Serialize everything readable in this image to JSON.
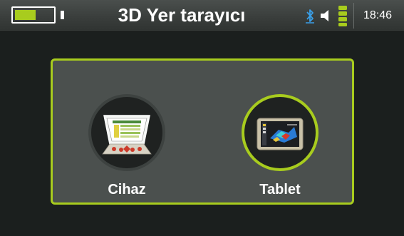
{
  "status_bar": {
    "battery_level": 0.55,
    "title": "3D Yer tarayıcı",
    "icons": [
      "battery-icon",
      "bluetooth-icon",
      "speaker-icon",
      "signal-icon"
    ],
    "time": "18:46"
  },
  "menu": {
    "options": [
      {
        "label": "Cihaz",
        "icon": "device-icon",
        "selected": false
      },
      {
        "label": "Tablet",
        "icon": "tablet-icon",
        "selected": true
      }
    ]
  },
  "colors": {
    "accent": "#a8cc1e",
    "background": "#1b1f1e",
    "panel": "#4b504e",
    "topbar": "#3a3e3c"
  }
}
